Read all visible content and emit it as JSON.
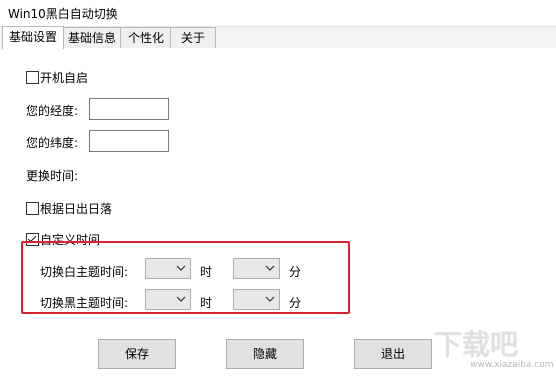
{
  "window": {
    "title": "Win10黑白自动切换"
  },
  "tabs": [
    {
      "label": "基础设置",
      "active": true
    },
    {
      "label": "基础信息",
      "active": false
    },
    {
      "label": "个性化",
      "active": false
    },
    {
      "label": "关于",
      "active": false
    }
  ],
  "settings": {
    "autostart": {
      "label": "开机自启",
      "checked": false
    },
    "longitude": {
      "label": "您的经度:",
      "value": ""
    },
    "latitude": {
      "label": "您的纬度:",
      "value": ""
    },
    "change_time_label": "更换时间:",
    "sunrise_sunset": {
      "label": "根据日出日落",
      "checked": false
    },
    "custom_time": {
      "label": "自定义时间",
      "checked": true
    },
    "white_theme": {
      "label": "切换白主题时间:",
      "hour_unit": "时",
      "minute_unit": "分",
      "hour": "",
      "minute": ""
    },
    "black_theme": {
      "label": "切换黑主题时间:",
      "hour_unit": "时",
      "minute_unit": "分",
      "hour": "",
      "minute": ""
    }
  },
  "buttons": {
    "save": "保存",
    "hide": "隐藏",
    "exit": "退出"
  },
  "watermark": {
    "text": "下载吧",
    "url": "www.xiazaiba.com"
  },
  "colors": {
    "highlight": "#d9232e"
  }
}
